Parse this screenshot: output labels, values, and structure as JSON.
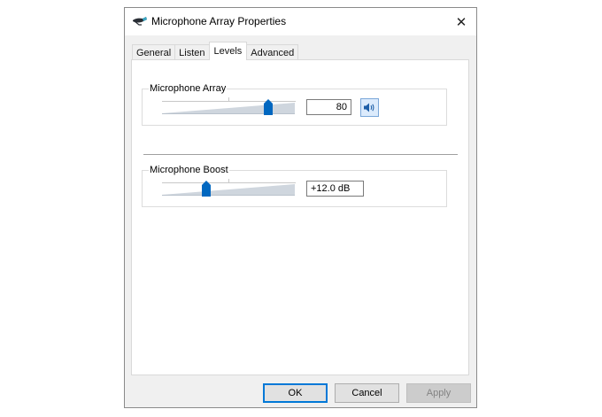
{
  "window": {
    "title": "Microphone Array Properties",
    "close_glyph": "✕",
    "icon": "microphone-device-icon"
  },
  "tabs": [
    {
      "label": "General",
      "active": false
    },
    {
      "label": "Listen",
      "active": false
    },
    {
      "label": "Levels",
      "active": true
    },
    {
      "label": "Advanced",
      "active": false
    }
  ],
  "levels": {
    "microphone_array": {
      "label": "Microphone Array",
      "value": "80",
      "slider_value": 80,
      "slider_min": 0,
      "slider_max": 100,
      "mute_icon": "speaker-volume-icon"
    },
    "microphone_boost": {
      "label": "Microphone Boost",
      "value": "+12.0 dB",
      "slider_value": 12,
      "slider_min": 0,
      "slider_max": 36
    }
  },
  "buttons": {
    "ok": "OK",
    "cancel": "Cancel",
    "apply": "Apply"
  },
  "colors": {
    "accent": "#0078d7",
    "thumb": "#0067c0",
    "track": "#cfd6de"
  }
}
